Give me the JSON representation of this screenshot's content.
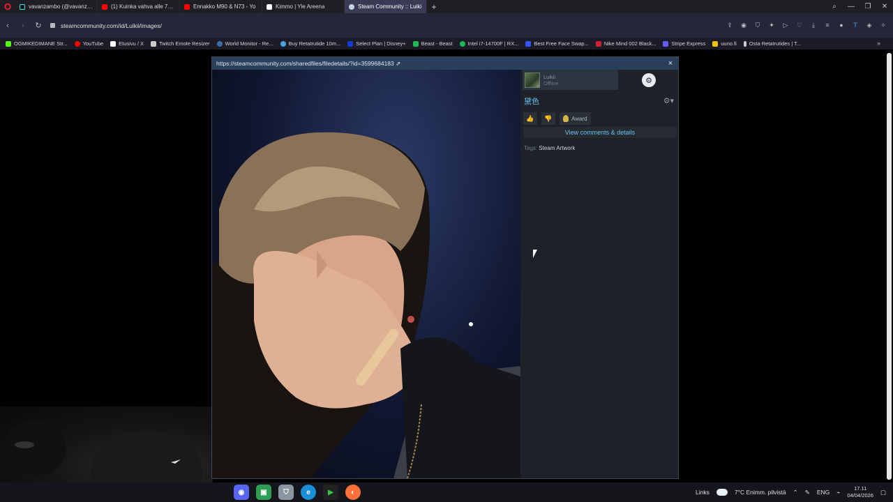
{
  "tabs": [
    {
      "label": "vavanzambo (@vavanzam",
      "color": "#111111",
      "active": false
    },
    {
      "label": "(1) Kuinka vahva alle 73 k",
      "color": "#ff0000",
      "active": false
    },
    {
      "label": "Ennakko M90 & N73 - Yo",
      "color": "#ff0000",
      "active": false
    },
    {
      "label": "Kimmo | Yle Areena",
      "color": "#ffffff",
      "active": false
    },
    {
      "label": "Steam Community :: Luiki",
      "color": "#1b2838",
      "active": true
    }
  ],
  "address": {
    "url": "steamcommunity.com/id/Luikii/images/"
  },
  "bookmarks": [
    {
      "label": "OGMIKEDIMANE Str...",
      "color": "#53fc18"
    },
    {
      "label": "YouTube",
      "color": "#ff0000"
    },
    {
      "label": "Etusivu / X",
      "color": "#ffffff"
    },
    {
      "label": "Twitch Emote Resizer",
      "color": "#cccccc"
    },
    {
      "label": "World Monitor - Re...",
      "color": "#3a6ea5"
    },
    {
      "label": "Buy Retatrutide 10m...",
      "color": "#4aa3df"
    },
    {
      "label": "Select Plan | Disney+",
      "color": "#113ccf"
    },
    {
      "label": "Beast - Beast",
      "color": "#1db954"
    },
    {
      "label": "Intel i7-14700F | RX...",
      "color": "#1db954"
    },
    {
      "label": "Best Free Face Swap...",
      "color": "#3355ff"
    },
    {
      "label": "Nike Mind 002 Black...",
      "color": "#cc2233"
    },
    {
      "label": "Stripe Express",
      "color": "#635bff"
    },
    {
      "label": "uuno.fi",
      "color": "#f2c200"
    },
    {
      "label": "Osta Retatrutides | T...",
      "color": "#cccccc"
    }
  ],
  "modal": {
    "link": "https://steamcommunity.com/sharedfiles/filedetails/?id=3599684183 ⇗",
    "close": "×",
    "author_name": "Luikii",
    "author_status": "Offline",
    "title": "黛色",
    "award_label": "Award",
    "comments_label": "View comments & details",
    "tags_prefix": "Tags:",
    "tag": "Steam Artwork"
  },
  "taskbar": {
    "links": "Links",
    "weather": "7°C  Enimm. pilvistä",
    "lang": "ENG",
    "time": "17.11",
    "date": "04/04/2026"
  }
}
